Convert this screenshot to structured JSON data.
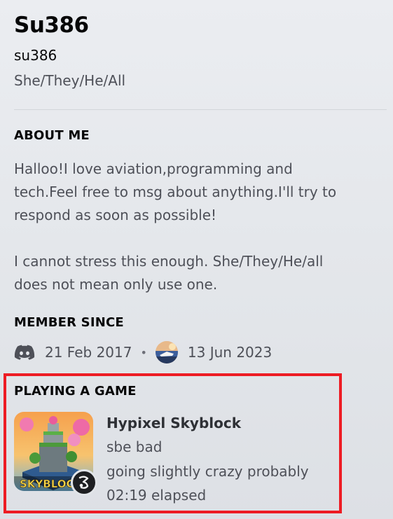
{
  "profile": {
    "display_name": "Su386",
    "username": "su386",
    "pronouns": "She/They/He/All"
  },
  "about": {
    "heading": "ABOUT ME",
    "text": "Halloo!I love aviation,programming and\ntech.Feel free to msg about anything.I'll try to\nrespond as soon as possible!\n\nI cannot stress this enough. She/They/He/all\ndoes not mean only use one."
  },
  "member_since": {
    "heading": "MEMBER SINCE",
    "discord_date": "21 Feb 2017",
    "separator": "•",
    "server_date": "13 Jun 2023"
  },
  "activity": {
    "heading": "PLAYING A GAME",
    "game_name": "Hypixel Skyblock",
    "details": "sbe bad",
    "state": "going slightly crazy probably",
    "elapsed": "02:19 elapsed",
    "art_text": "SKYBLOC"
  },
  "colors": {
    "highlight_border": "#ed1c24",
    "discord_icon": "#4e5058"
  },
  "icons": [
    "discord-icon",
    "server-avatar-icon",
    "game-art-icon",
    "game-badge-icon"
  ]
}
